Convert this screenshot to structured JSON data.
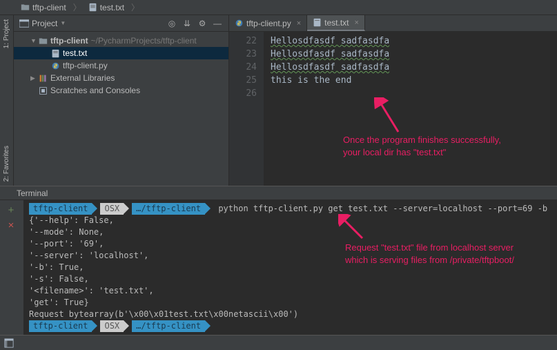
{
  "breadcrumb": {
    "root": "tftp-client",
    "file": "test.txt"
  },
  "sidebar_tabs": {
    "project": "1: Project",
    "favorites": "2: Favorites"
  },
  "project_panel": {
    "title": "Project",
    "tree": {
      "root": "tftp-client",
      "root_path": "~/PycharmProjects/tftp-client",
      "file_txt": "test.txt",
      "file_py": "tftp-client.py",
      "ext_lib": "External Libraries",
      "scratch": "Scratches and Consoles"
    }
  },
  "editor": {
    "tabs": {
      "py": "tftp-client.py",
      "txt": "test.txt"
    },
    "line_numbers": [
      "22",
      "23",
      "24",
      "25",
      "26"
    ],
    "lines": {
      "l22": "Hellosdfasdf sadfasdfa",
      "l23": "Hellosdfasdf sadfasdfa",
      "l24": "Hellosdfasdf sadfasdfa",
      "l25": "this is the end"
    },
    "annotation": "Once the program finishes successfully, your local dir has \"test.txt\""
  },
  "terminal": {
    "title": "Terminal",
    "prompt": {
      "seg1": "tftp-client",
      "seg2": "OSX",
      "seg3": "…/tftp-client"
    },
    "command": "python tftp-client.py get test.txt --server=localhost --port=69 -b",
    "output": [
      "{'--help': False,",
      " '--mode': None,",
      " '--port': '69',",
      " '--server': 'localhost',",
      " '-b': True,",
      " '-s': False,",
      " '<filename>': 'test.txt',",
      " 'get': True}",
      "Request bytearray(b'\\x00\\x01test.txt\\x00netascii\\x00')"
    ],
    "annotation": "Request \"test.txt\" file from localhost server which is serving files from /private/tftpboot/"
  }
}
